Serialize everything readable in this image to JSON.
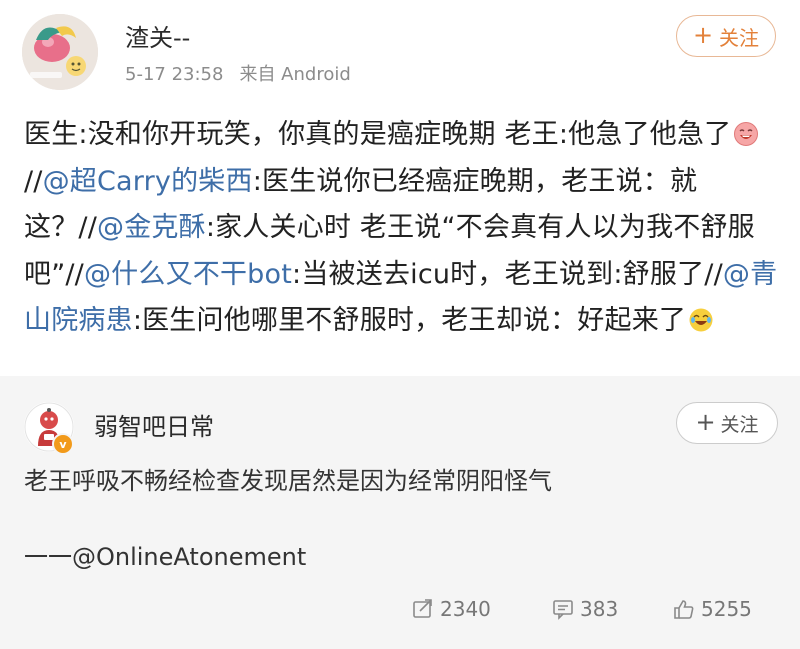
{
  "post": {
    "username": "渣关--",
    "time": "5-17 23:58",
    "source": "来自 Android",
    "follow_label": "关注",
    "follow_plus": "+",
    "body": {
      "seg1": "医生:没和你开玩笑，你真的是癌症晚期 老王:他急了他急了",
      "sl1": "//",
      "m1": "@超Carry的柴西",
      "seg2": ":医生说你已经癌症晚期，老王说：就这？",
      "sl2": "//",
      "m2": "@金克酥",
      "seg3": ":家人关心时 老王说“不会真有人以为我不舒服吧”",
      "sl3": "//",
      "m3": "@什么又不干bot",
      "seg4": ":当被送去icu时，老王说到:舒服了",
      "sl4": "//",
      "m4": "@青山院病患",
      "seg5": ":医生问他哪里不舒服时，老王却说：好起来了"
    },
    "emoji": {
      "after_seg1": "grinning-face-emoji",
      "after_seg5": "crying-laughing-face-emoji"
    }
  },
  "original": {
    "username": "弱智吧日常",
    "follow_label": "关注",
    "follow_plus": "+",
    "text": "老王呼吸不畅经检查发现居然是因为经常阴阳怪气",
    "signature": "一一@OnlineAtonement",
    "stats": {
      "reposts": "2340",
      "comments": "383",
      "likes": "5255"
    }
  },
  "colors": {
    "link": "#3e6ea8",
    "follow_orange": "#e3813a",
    "card_bg": "#f5f5f5",
    "meta_gray": "#8c8c8c"
  },
  "icons": [
    "repost-icon",
    "comment-icon",
    "like-icon",
    "verified-badge-icon"
  ]
}
